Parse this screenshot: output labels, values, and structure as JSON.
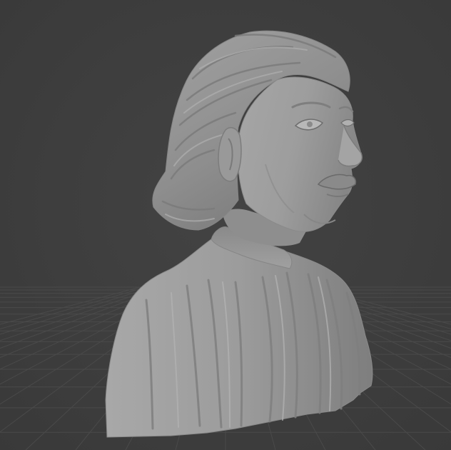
{
  "viewport": {
    "background_color": "#3d3d3d",
    "grid_color": "#4a4a4a",
    "model": {
      "kind": "sculpted-bust",
      "material_color": "#9a9a9a"
    }
  }
}
